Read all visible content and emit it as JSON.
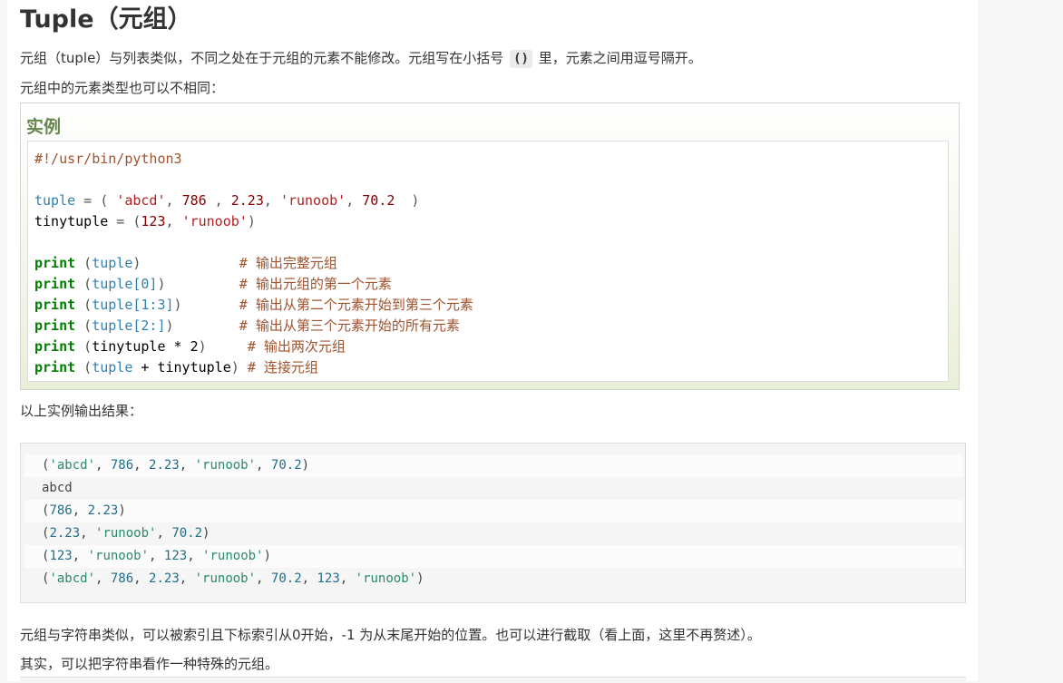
{
  "page": {
    "title": "Tuple（元组）",
    "intro_before_code": "元组（tuple）与列表类似，不同之处在于元组的元素不能修改。元组写在小括号 ",
    "intro_code": "()",
    "intro_after_code": " 里，元素之间用逗号隔开。",
    "intro2": "元组中的元素类型也可以不相同：",
    "example_heading": "实例",
    "result_intro": "以上实例输出结果：",
    "para_after_1": "元组与字符串类似，可以被索引且下标索引从0开始，-1 为从末尾开始的位置。也可以进行截取（看上面，这里不再赘述）。",
    "para_after_2": "其实，可以把字符串看作一种特殊的元组。"
  },
  "code": {
    "shebang": "#!/usr/bin/python3",
    "l1": {
      "var": "tuple",
      "eq": " = ( ",
      "s1": "'abcd'",
      "c1": ", ",
      "n1": "786",
      "c2": " , ",
      "n2": "2.23",
      "c3": ", ",
      "s2": "'runoob'",
      "c4": ", ",
      "n3": "70.2",
      "end": "  )"
    },
    "l2": {
      "name": "tinytuple",
      "eq": " = (",
      "n1": "123",
      "c1": ", ",
      "s1": "'runoob'",
      "end": ")"
    },
    "prints": [
      {
        "kw": "print",
        "open": " (",
        "var": "tuple",
        "rest": "",
        "close": ")",
        "pad": "            ",
        "comment": "# 输出完整元组"
      },
      {
        "kw": "print",
        "open": " (",
        "var": "tuple",
        "rest": "[0]",
        "close": ")",
        "pad": "         ",
        "comment": "# 输出元组的第一个元素"
      },
      {
        "kw": "print",
        "open": " (",
        "var": "tuple",
        "rest": "[1:3]",
        "close": ")",
        "pad": "       ",
        "comment": "# 输出从第二个元素开始到第三个元素"
      },
      {
        "kw": "print",
        "open": " (",
        "var": "tuple",
        "rest": "[2:]",
        "close": ")",
        "pad": "        ",
        "comment": "# 输出从第三个元素开始的所有元素"
      },
      {
        "kw": "print",
        "open": " (",
        "var": "tinytuple * 2",
        "rest": "",
        "close": ")",
        "pad": "     ",
        "comment": "# 输出两次元组"
      },
      {
        "kw": "print",
        "open": " (",
        "var": "tuple",
        "rest": " + tinytuple",
        "close": ")",
        "pad": " ",
        "comment": "# 连接元组"
      }
    ]
  },
  "output": [
    "('abcd', 786, 2.23, 'runoob', 70.2)",
    "abcd",
    "(786, 2.23)",
    "(2.23, 'runoob', 70.2)",
    "(123, 'runoob', 123, 'runoob')",
    "('abcd', 786, 2.23, 'runoob', 70.2, 123, 'runoob')"
  ]
}
